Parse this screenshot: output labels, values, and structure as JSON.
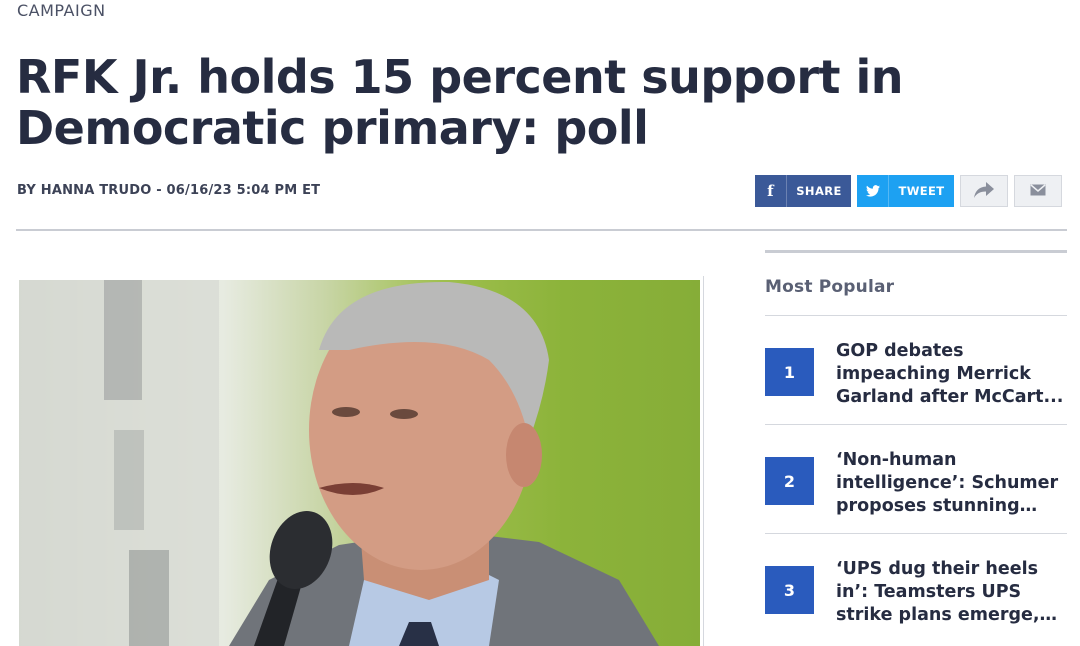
{
  "article": {
    "section": "CAMPAIGN",
    "headline": "RFK Jr. holds 15 percent support in Democratic primary: poll",
    "byline": "BY HANNA TRUDO - 06/16/23 5:04 PM ET"
  },
  "share": {
    "facebook_label": "SHARE",
    "twitter_label": "TWEET",
    "facebook_icon": "facebook-icon",
    "twitter_icon": "twitter-icon",
    "forward_icon": "share-arrow-icon",
    "email_icon": "email-icon"
  },
  "sidebar": {
    "title": "Most Popular",
    "items": [
      {
        "rank": "1",
        "title": "GOP debates impeaching Merrick Garland after McCart..."
      },
      {
        "rank": "2",
        "title": "‘Non-human intelligence’: Schumer proposes stunning ne..."
      },
      {
        "rank": "3",
        "title": "‘UPS dug their heels in’: Teamsters UPS strike plans emerge, could..."
      }
    ]
  },
  "colors": {
    "headline": "#262c41",
    "facebook": "#3b5998",
    "twitter": "#1da1f2",
    "rank_badge": "#2a5bbd"
  }
}
